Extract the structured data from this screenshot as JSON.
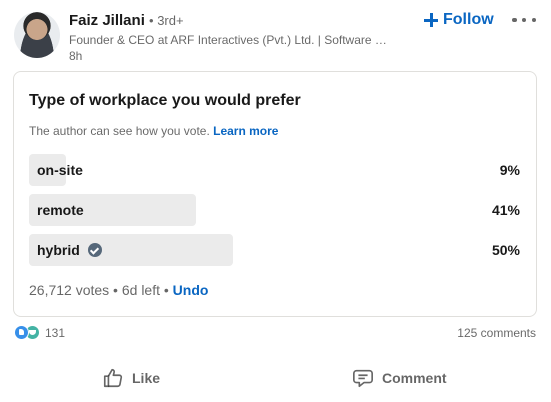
{
  "author": {
    "name": "Faiz Jillani",
    "degree": "• 3rd+",
    "headline": "Founder & CEO at ARF Interactives (Pvt.) Ltd. | Software …",
    "time": "8h"
  },
  "header": {
    "follow_label": "Follow",
    "follow_icon": "plus-icon",
    "more_icon": "more-horizontal-icon"
  },
  "poll": {
    "question": "Type of workplace you would prefer",
    "note": "The author can see how you vote.",
    "learn_more": "Learn more",
    "options": [
      {
        "label": "on-site",
        "percent": "9%",
        "fraction": 0.09,
        "selected": false
      },
      {
        "label": "remote",
        "percent": "41%",
        "fraction": 0.41,
        "selected": false
      },
      {
        "label": "hybrid",
        "percent": "50%",
        "fraction": 0.5,
        "selected": true
      }
    ],
    "footer": "26,712 votes • 6d left •",
    "undo": "Undo"
  },
  "social": {
    "reaction_count": "131",
    "comments": "125 comments"
  },
  "actions": {
    "like": "Like",
    "comment": "Comment"
  },
  "colors": {
    "accent": "#0a66c2",
    "bar": "#ebebeb",
    "muted_text": "#666666"
  }
}
